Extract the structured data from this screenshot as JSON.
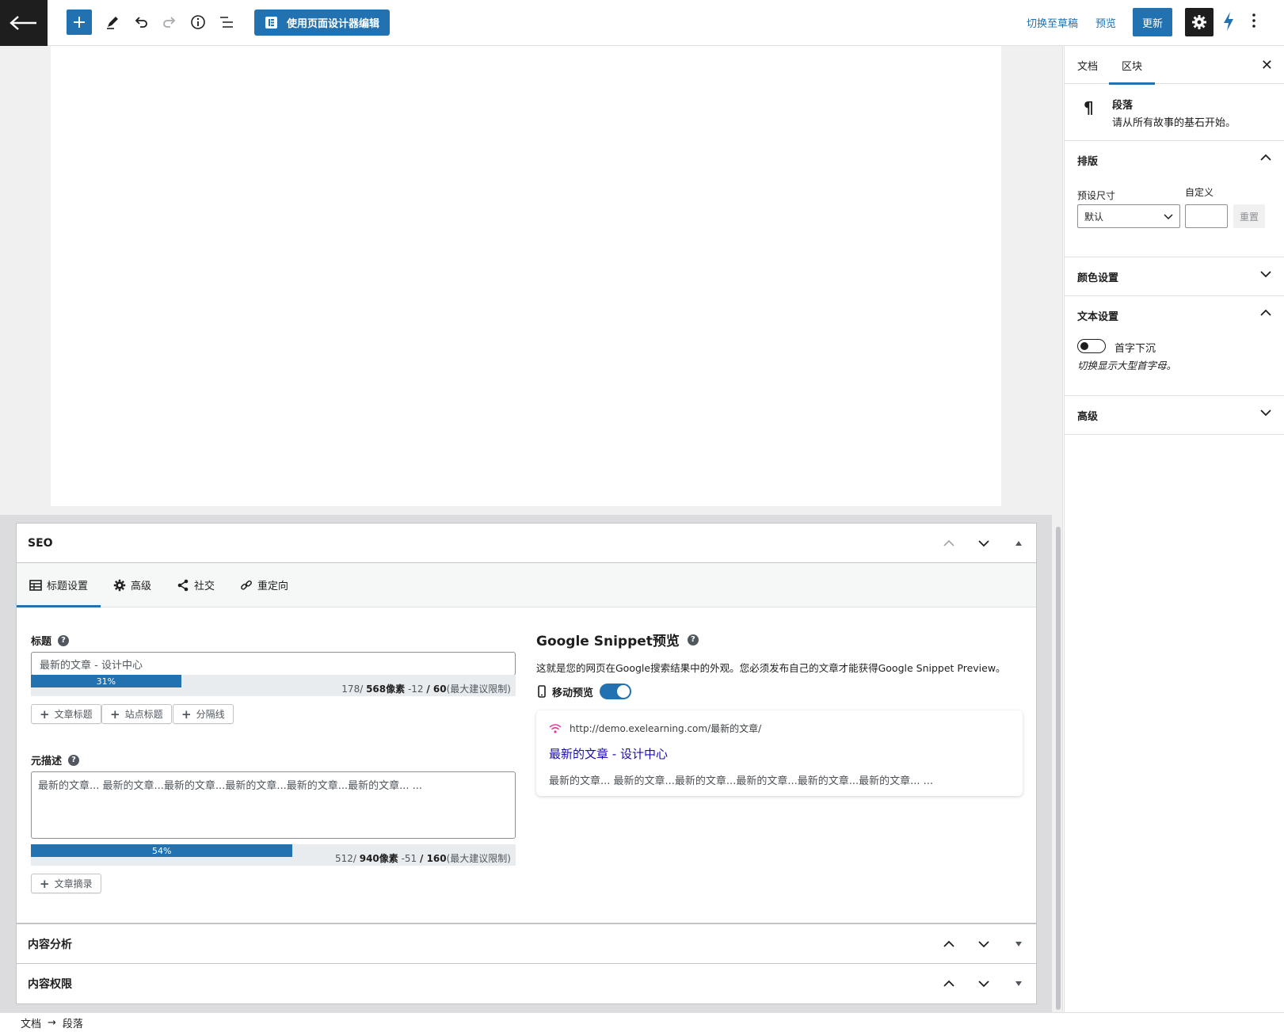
{
  "toolbar": {
    "designer_label": "使用页面设计器编辑",
    "switch_draft": "切换至草稿",
    "preview": "预览",
    "update": "更新"
  },
  "seo": {
    "title": "SEO",
    "tabs": [
      {
        "label": "标题设置",
        "icon": "table-icon"
      },
      {
        "label": "高级",
        "icon": "gear-icon"
      },
      {
        "label": "社交",
        "icon": "share-icon"
      },
      {
        "label": "重定向",
        "icon": "link-icon"
      }
    ],
    "title_field": {
      "label": "标题",
      "value": "最新的文章 - 设计中心",
      "meter_percent": 31,
      "meter_label": "31%",
      "stat_count": "178/ ",
      "stat_px": "568像素",
      "stat_diff": " -12 ",
      "stat_limit": "/ 60",
      "stat_suffix": "(最大建议限制)",
      "tags": [
        "文章标题",
        "站点标题",
        "分隔线"
      ]
    },
    "desc_field": {
      "label": "元描述",
      "value": "最新的文章... 最新的文章...最新的文章...最新的文章...最新的文章...最新的文章... ...",
      "meter_percent": 54,
      "meter_label": "54%",
      "stat_count": "512/ ",
      "stat_px": "940像素",
      "stat_diff": " -51 ",
      "stat_limit": "/ 160",
      "stat_suffix": "(最大建议限制)",
      "tags": [
        "文章摘录"
      ]
    },
    "snippet": {
      "heading": "Google Snippet预览",
      "description": "这就是您的网页在Google搜索结果中的外观。您必须发布自己的文章才能获得Google Snippet Preview。",
      "mobile_label": "移动预览",
      "url": "http://demo.exelearning.com/最新的文章/",
      "title": "最新的文章 - 设计中心",
      "desc": "最新的文章... 最新的文章...最新的文章...最新的文章...最新的文章...最新的文章... ..."
    }
  },
  "content_analysis": {
    "title": "内容分析"
  },
  "content_access": {
    "title": "内容权限"
  },
  "breadcrumb": {
    "root": "文档",
    "arrow": "→",
    "current": "段落"
  },
  "sidebar": {
    "tab_document": "文档",
    "tab_block": "区块",
    "close": "✕",
    "block_name": "段落",
    "block_desc": "请从所有故事的基石开始。",
    "typography": {
      "title": "排版",
      "preset_label": "预设尺寸",
      "custom_label": "自定义",
      "preset_value": "默认",
      "reset": "重置"
    },
    "color_title": "颜色设置",
    "text_settings": {
      "title": "文本设置",
      "dropcap_label": "首字下沉",
      "dropcap_help": "切换显示大型首字母。"
    },
    "advanced_title": "高级"
  }
}
